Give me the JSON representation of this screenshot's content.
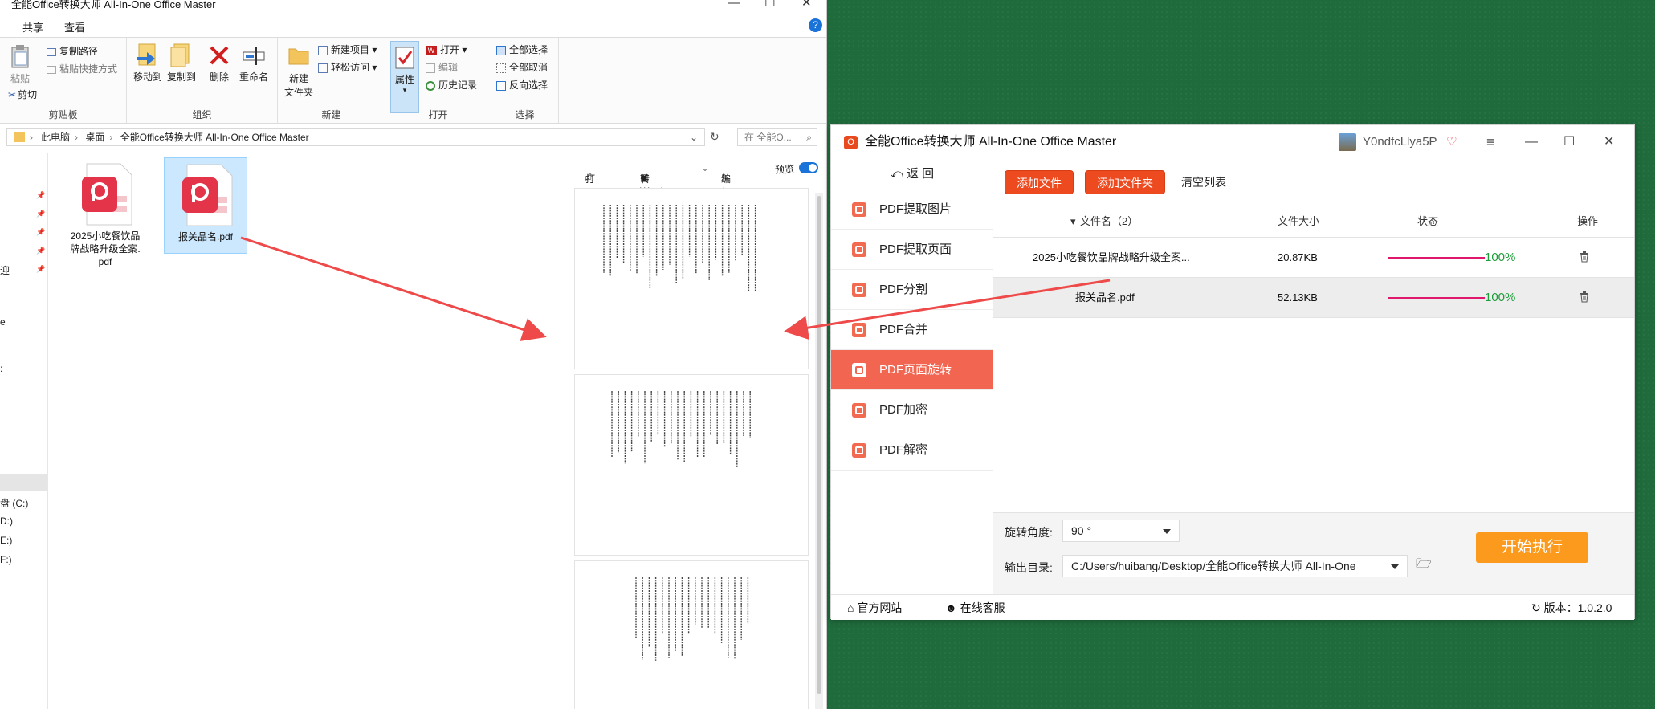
{
  "explorer": {
    "title": "全能Office转换大师 All-In-One Office Master",
    "tabs": [
      "共享",
      "查看"
    ],
    "ribbon": {
      "clipboard": {
        "paste": "粘贴",
        "copy_path": "复制路径",
        "paste_shortcut": "粘贴快捷方式",
        "cut": "剪切",
        "group": "剪贴板"
      },
      "organize": {
        "move_to": "移动到",
        "copy_to": "复制到",
        "delete": "删除",
        "rename": "重命名",
        "group": "组织"
      },
      "new": {
        "new_item": "新建项目",
        "easy_access": "轻松访问",
        "new_folder_1": "新建",
        "new_folder_2": "文件夹",
        "group": "新建"
      },
      "open": {
        "properties": "属性",
        "open": "打开",
        "edit": "编辑",
        "history": "历史记录",
        "group": "打开"
      },
      "select": {
        "select_all": "全部选择",
        "select_none": "全部取消",
        "invert": "反向选择",
        "group": "选择"
      }
    },
    "address": {
      "crumbs": [
        "此电脑",
        "桌面",
        "全能Office转换大师 All-In-One Office Master"
      ],
      "search_placeholder": "在 全能O..."
    },
    "nav": {
      "frag1": "迎",
      "frag2": "e",
      "frag3": ":",
      "drives": [
        "盘 (C:)",
        "D:)",
        "E:)",
        "F:)"
      ]
    },
    "files": [
      {
        "name_l1": "2025小吃餐饮品",
        "name_l2": "牌战略升级全案.",
        "name_l3": "pdf"
      },
      {
        "name_l1": "报关品名.pdf"
      }
    ],
    "preview_toolbar": {
      "print": "打印",
      "to_word": "转Word",
      "edit": "编辑",
      "preview": "预览"
    }
  },
  "app": {
    "title": "全能Office转换大师 All-In-One Office Master",
    "username": "Y0ndfcLlya5P",
    "back": "返 回",
    "sidebar": [
      "PDF提取图片",
      "PDF提取页面",
      "PDF分割",
      "PDF合并",
      "PDF页面旋转",
      "PDF加密",
      "PDF解密"
    ],
    "active_index": 4,
    "buttons": {
      "add_file": "添加文件",
      "add_folder": "添加文件夹",
      "clear": "清空列表"
    },
    "table": {
      "headers": {
        "name": "文件名（2）",
        "size": "文件大小",
        "status": "状态",
        "action": "操作"
      },
      "rows": [
        {
          "name": "2025小吃餐饮品牌战略升级全案...",
          "size": "20.87KB",
          "progress": "100%"
        },
        {
          "name": "报关品名.pdf",
          "size": "52.13KB",
          "progress": "100%"
        }
      ]
    },
    "options": {
      "rotation_label": "旋转角度:",
      "rotation_value": "90 °",
      "output_label": "输出目录:",
      "output_value": "C:/Users/huibang/Desktop/全能Office转换大师 All-In-One"
    },
    "start": "开始执行",
    "footer": {
      "website": "官方网站",
      "support": "在线客服",
      "version": "版本：1.0.2.0"
    },
    "colors": {
      "accent": "#f26551",
      "button": "#ee4a1f",
      "start": "#fb9a1c",
      "progress": "#e0186c",
      "percent": "#1e9d3a"
    }
  }
}
